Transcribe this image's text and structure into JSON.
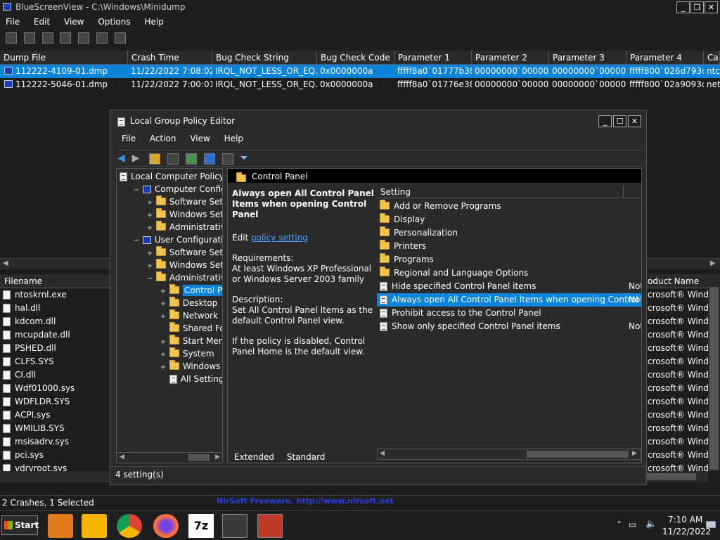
{
  "main_window": {
    "title": "BlueScreenView  -  C:\\Windows\\Minidump",
    "menu": [
      "File",
      "Edit",
      "View",
      "Options",
      "Help"
    ]
  },
  "dump_table": {
    "columns": [
      "Dump File",
      "Crash Time",
      "Bug Check String",
      "Bug Check Code",
      "Parameter 1",
      "Parameter 2",
      "Parameter 3",
      "Parameter 4",
      "Ca"
    ],
    "rows": [
      [
        "112222-4109-01.dmp",
        "11/22/2022 7:08:02...",
        "IRQL_NOT_LESS_OR_EQ...",
        "0x0000000a",
        "fffff8a0`01777b38",
        "00000000`000000...",
        "00000000`000000...",
        "fffff800`026d793c",
        "ntc"
      ],
      [
        "112222-5046-01.dmp",
        "11/22/2022 7:00:01...",
        "IRQL_NOT_LESS_OR_EQ...",
        "0x0000000a",
        "fffff8a0`01776e38",
        "00000000`000000...",
        "00000000`000000...",
        "fffff800`02a9093c",
        "net"
      ]
    ]
  },
  "file_table": {
    "col_filename": "Filename",
    "col_product": "oduct Name",
    "files": [
      "ntoskrnl.exe",
      "hal.dll",
      "kdcom.dll",
      "mcupdate.dll",
      "PSHED.dll",
      "CLFS.SYS",
      "CI.dll",
      "Wdf01000.sys",
      "WDFLDR.SYS",
      "ACPI.sys",
      "WMILIB.SYS",
      "msisadrv.sys",
      "pci.sys",
      "vdrvroot.sys"
    ],
    "products": [
      "crosoft® Wind...",
      "crosoft® Wind...",
      "crosoft® Wind...",
      "crosoft® Wind...",
      "crosoft® Wind...",
      "crosoft® Wind...",
      "crosoft® Wind...",
      "crosoft® Wind...",
      "crosoft® Wind...",
      "crosoft® Wind...",
      "crosoft® Wind...",
      "crosoft® Wind...",
      "crosoft® Wind...",
      "crosoft® Wind..."
    ]
  },
  "status": {
    "left": "2 Crashes, 1 Selected",
    "right": "NirSoft Freeware.  http://www.nirsoft.net"
  },
  "gpedit": {
    "title": "Local Group Policy Editor",
    "menu": [
      "File",
      "Action",
      "View",
      "Help"
    ],
    "tree": [
      {
        "label": "Local Computer Policy",
        "sign": ""
      },
      {
        "label": "Computer Configura",
        "sign": "−"
      },
      {
        "label": "Software Settings",
        "sign": "+"
      },
      {
        "label": "Windows Setting",
        "sign": "+"
      },
      {
        "label": "Administrative Te",
        "sign": "+"
      },
      {
        "label": "User Configuration",
        "sign": "−"
      },
      {
        "label": "Software Settings",
        "sign": "+"
      },
      {
        "label": "Windows Setting",
        "sign": "+"
      },
      {
        "label": "Administrative Te",
        "sign": "−"
      },
      {
        "label": "Control Panel",
        "sign": "+"
      },
      {
        "label": "Desktop",
        "sign": "+"
      },
      {
        "label": "Network",
        "sign": "+"
      },
      {
        "label": "Shared Folder",
        "sign": ""
      },
      {
        "label": "Start Menu ar",
        "sign": "+"
      },
      {
        "label": "System",
        "sign": "+"
      },
      {
        "label": "Windows Cor",
        "sign": "+"
      },
      {
        "label": "All Settings",
        "sign": ""
      }
    ],
    "panel_header": "Control Panel",
    "desc": {
      "title": "Always open All Control Panel Items when opening Control Panel",
      "edit_prefix": "Edit ",
      "edit_link": "policy setting",
      "req_label": "Requirements:",
      "req_text": "At least Windows XP Professional or Windows Server 2003 family",
      "desc_label": "Description:",
      "desc_text": "Set All Control Panel Items as the default Control Panel view.",
      "disabled_text": "If the policy is disabled, Control Panel Home is the default view."
    },
    "settings_col": "Setting",
    "settings": [
      {
        "label": "Add or Remove Programs",
        "type": "folder",
        "state": ""
      },
      {
        "label": "Display",
        "type": "folder",
        "state": ""
      },
      {
        "label": "Personalization",
        "type": "folder",
        "state": ""
      },
      {
        "label": "Printers",
        "type": "folder",
        "state": ""
      },
      {
        "label": "Programs",
        "type": "folder",
        "state": ""
      },
      {
        "label": "Regional and Language Options",
        "type": "folder",
        "state": ""
      },
      {
        "label": "Hide specified Control Panel items",
        "type": "policy",
        "state": "Not"
      },
      {
        "label": "Always open All Control Panel Items when opening Control ...",
        "type": "policy",
        "state": "Not"
      },
      {
        "label": "Prohibit access to the Control Panel",
        "type": "policy",
        "state": ""
      },
      {
        "label": "Show only specified Control Panel items",
        "type": "policy",
        "state": "Not"
      }
    ],
    "tabs": [
      "Extended",
      "Standard"
    ],
    "status": "4 setting(s)"
  },
  "taskbar": {
    "start": "Start",
    "time": "7:10 AM",
    "date": "11/22/2022"
  }
}
